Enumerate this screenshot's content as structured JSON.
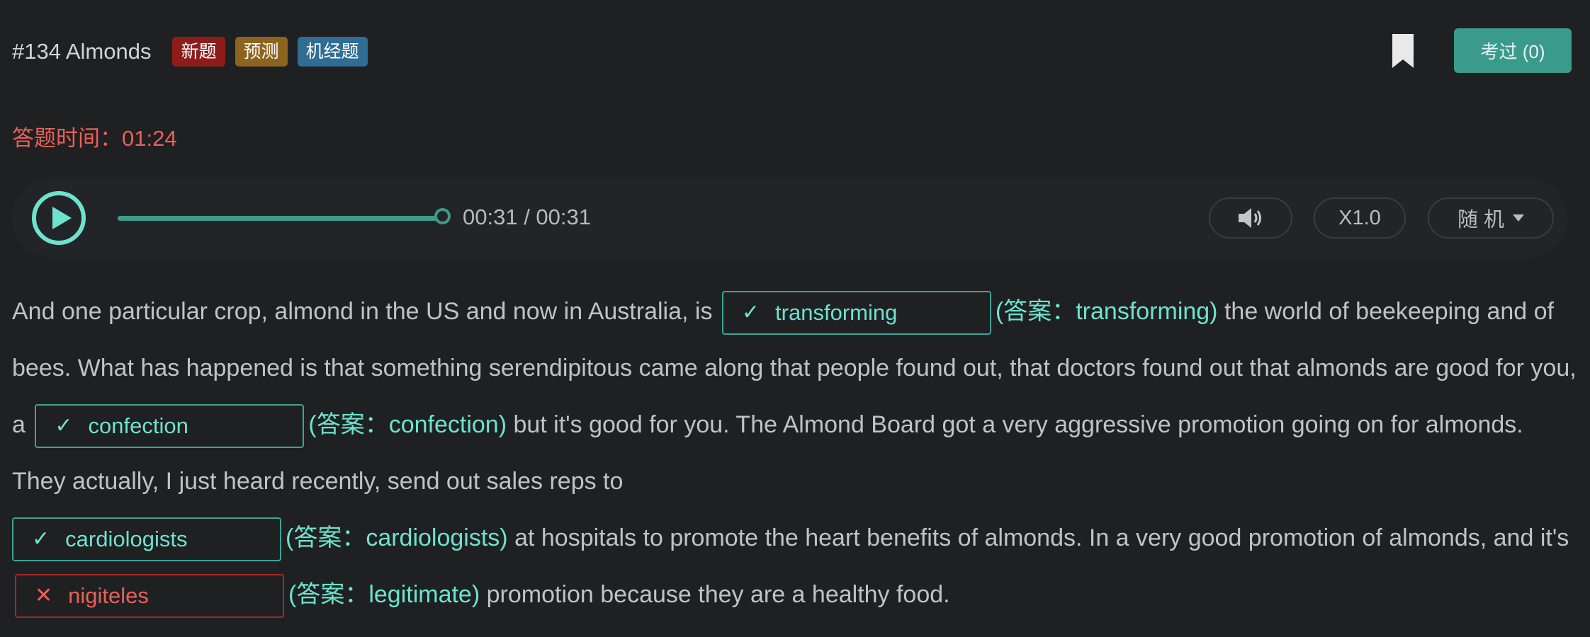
{
  "header": {
    "title": "#134 Almonds",
    "badges": [
      "新题",
      "预测",
      "机经题"
    ],
    "passed_label": "考过 (0)"
  },
  "timer": {
    "label": "答题时间：",
    "value": "01:24"
  },
  "player": {
    "time": "00:31 / 00:31",
    "progress": 1.0,
    "speed": "X1.0",
    "mode": "随 机"
  },
  "passage": {
    "seg1": "And one particular crop, almond in the US and now in Australia, is",
    "blank1": {
      "value": "transforming",
      "status": "correct"
    },
    "answer1": "(答案：transforming)",
    "seg2": "the world of beekeeping and of bees. What has happened is that something serendipitous came along that people found out, that doctors found out that almonds are good for you, a",
    "blank2": {
      "value": "confection",
      "status": "correct"
    },
    "answer2": "(答案：confection)",
    "seg3": "but it's good for you. The Almond Board got a very aggressive promotion going on for almonds. They actually, I just heard recently, send out sales reps to",
    "blank3": {
      "value": "cardiologists",
      "status": "correct"
    },
    "answer3": "(答案：cardiologists)",
    "seg4": "at hospitals to promote the heart benefits of almonds. In a very good promotion of almonds, and it's",
    "blank4": {
      "value": "nigiteles",
      "status": "wrong"
    },
    "answer4": "(答案：legitimate)",
    "seg5": "promotion because they are a healthy food."
  },
  "icons": {
    "bookmark": "bookmark-icon",
    "play": "play-icon",
    "volume": "volume-icon",
    "check": "check-icon",
    "cross": "cross-icon"
  },
  "colors": {
    "accent": "#3a9b8d",
    "correct": "#6de3cd",
    "wrong": "#e8615a"
  }
}
